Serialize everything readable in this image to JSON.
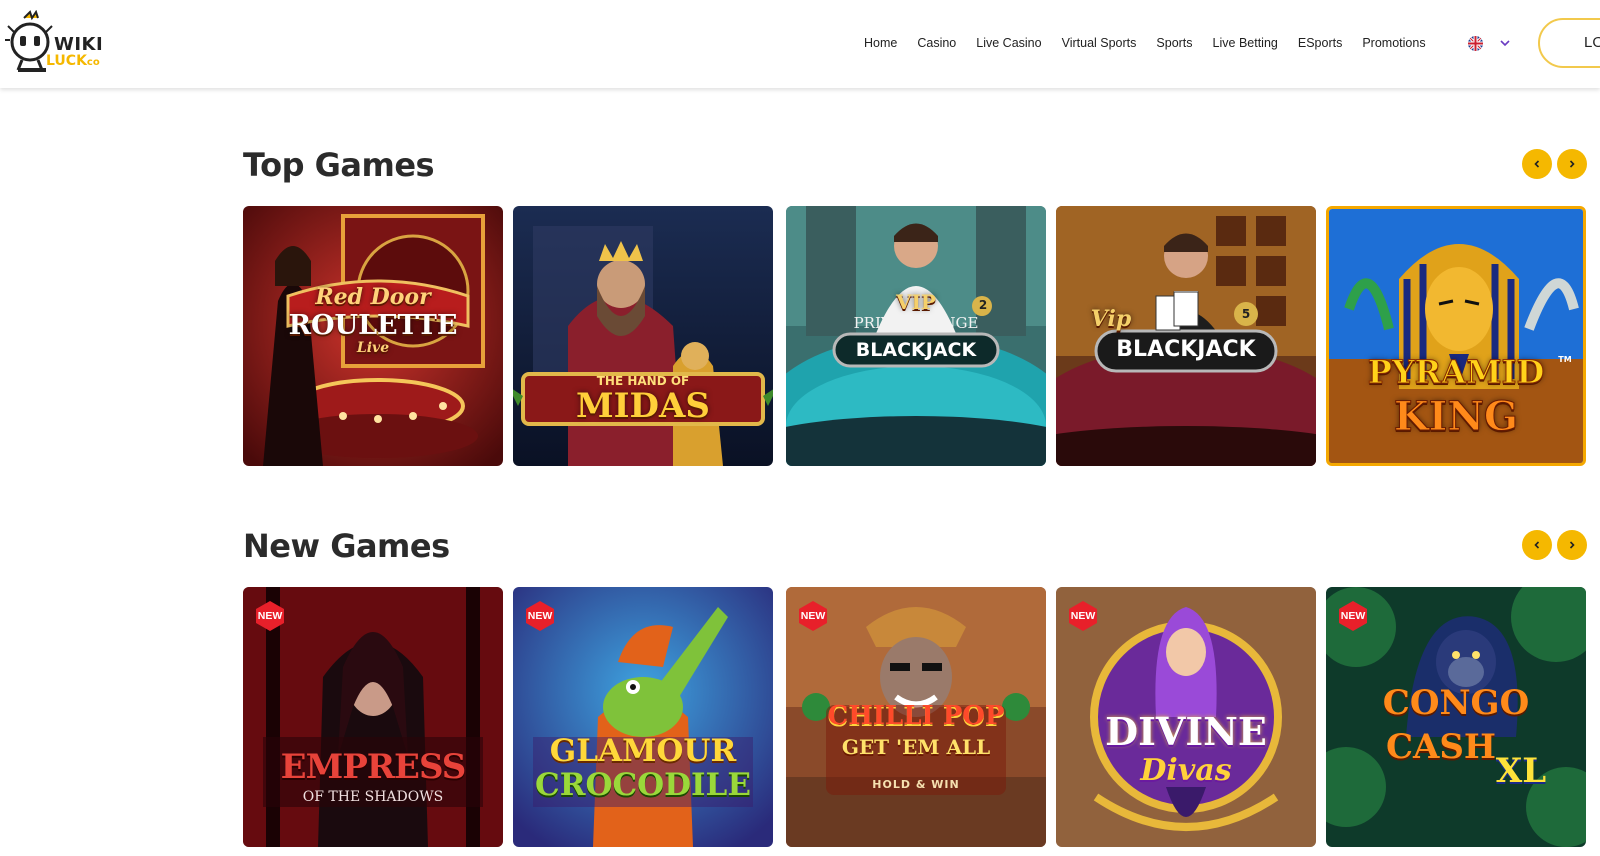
{
  "logo": {
    "top": "WIKI",
    "bottom": "LUCK",
    "suffix": "co"
  },
  "nav": [
    "Home",
    "Casino",
    "Live Casino",
    "Virtual Sports",
    "Sports",
    "Live Betting",
    "ESports",
    "Promotions"
  ],
  "login_label": "LOGIN",
  "top_games": {
    "title": "Top Games",
    "games": [
      {
        "line1": "Red Door",
        "line2": "ROULETTE",
        "line3": "Live"
      },
      {
        "line1": "THE HAND OF",
        "line2": "MIDAS"
      },
      {
        "line1": "VIP",
        "line2": "PRIVÉ LOUNGE",
        "line3": "BLACKJACK",
        "num": "2"
      },
      {
        "line1": "Vip",
        "line2": "BLACKJACK",
        "num": "5"
      },
      {
        "line1": "PYRAMID",
        "line2": "KING",
        "tm": "TM"
      }
    ]
  },
  "new_games": {
    "title": "New Games",
    "badge": "NEW",
    "games": [
      {
        "line1": "EMPRESS",
        "line2": "OF THE SHADOWS"
      },
      {
        "line1": "GLAMOUR",
        "line2": "CROCODILE"
      },
      {
        "line1": "CHILLI POP",
        "line2": "GET 'EM ALL",
        "line3": "HOLD & WIN"
      },
      {
        "line1": "DIVINE",
        "line2": "Divas"
      },
      {
        "line1": "CONGO",
        "line2": "CASH",
        "line3": "XL"
      }
    ]
  },
  "colors": {
    "accent": "#f5b800",
    "badge": "#e8202a"
  }
}
